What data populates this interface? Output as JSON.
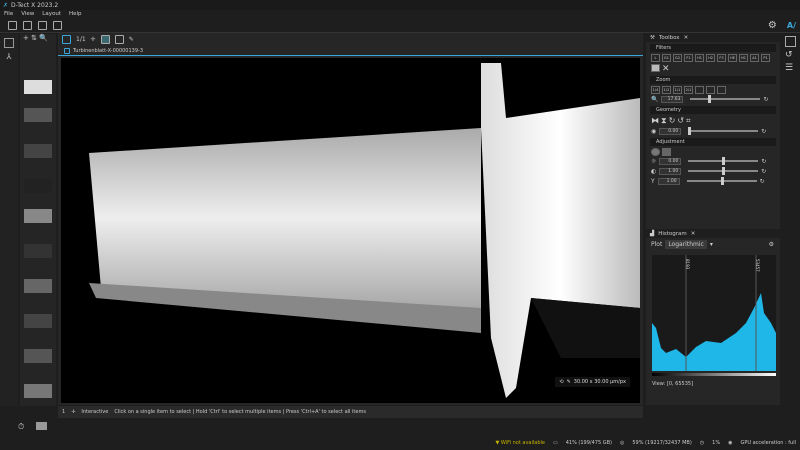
{
  "app": {
    "title": "D-Tect X 2023.2"
  },
  "menu": [
    "File",
    "View",
    "Layout",
    "Help"
  ],
  "viewer": {
    "page": "1/1",
    "tab": "Turbinenblatt-X-00000139-3",
    "pixel_size": "30.00 x 30.00 µm/px"
  },
  "status": {
    "index": "1",
    "mode": "Interactive",
    "hint": "Click on a single item to select | Hold 'Ctrl' to select multiple items | Press 'Ctrl+A' to select all items"
  },
  "toolbox": {
    "title": "Toolbox",
    "filters_label": "Filters",
    "filter_buttons": [
      "L",
      "G1",
      "G2",
      "F1",
      "H1",
      "H2",
      "F3",
      "HE",
      "HC",
      "A1",
      "P1"
    ],
    "zoom_label": "Zoom",
    "zoom_buttons": [
      "1/4",
      "1/2",
      "1/1",
      "2/1"
    ],
    "zoom_value": "17.63",
    "geometry_label": "Geometry",
    "rotation_value": "0.00",
    "adjustment_label": "Adjustment",
    "brightness": "0.00",
    "contrast": "1.00",
    "gamma": "1.00"
  },
  "histogram": {
    "title": "Histogram",
    "plot_label": "Plot",
    "plot_mode": "Logarithmic",
    "marker_low": "8193",
    "marker_high": "53457",
    "view_range": "View: [0, 65535]",
    "accent": "#1fb6e8"
  },
  "bottom": {
    "wifi": "WiFi not available",
    "disk": "41% (199/475 GB)",
    "memory": "59% (19217/32437 MB)",
    "cpu": "1%",
    "gpu": "GPU acceleration : full"
  }
}
